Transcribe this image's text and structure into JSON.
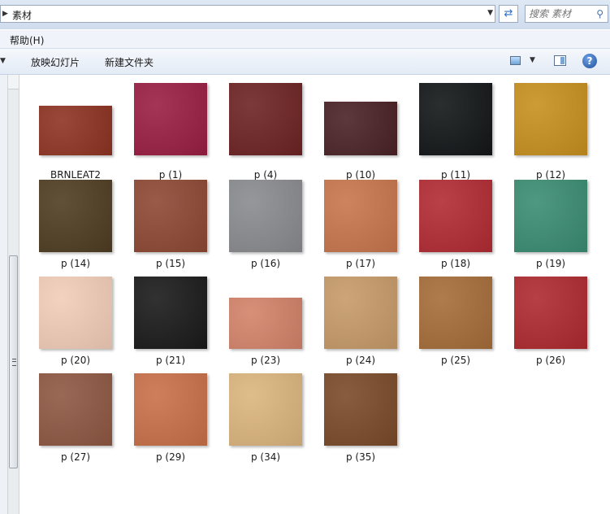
{
  "address": {
    "path": "素材"
  },
  "search": {
    "placeholder": "搜索 素材"
  },
  "menu": {
    "help_label": "帮助(H)"
  },
  "toolbar": {
    "slideshow_label": "放映幻灯片",
    "new_folder_label": "新建文件夹"
  },
  "icons": {
    "back": "triangle-right-icon",
    "dropdown": "chevron-down-icon",
    "refresh": "refresh-icon",
    "search": "search-icon",
    "views": "change-view-icon",
    "preview_pane": "preview-pane-icon",
    "help": "help-icon"
  },
  "files": [
    {
      "name": "BRNLEAT2",
      "color": "#8e3322"
    },
    {
      "name": "p (1)",
      "color": "#9b1e44"
    },
    {
      "name": "p (4)",
      "color": "#6e2324"
    },
    {
      "name": "p (10)",
      "color": "#4a2226"
    },
    {
      "name": "p (11)",
      "color": "#131618"
    },
    {
      "name": "p (12)",
      "color": "#c8901f"
    },
    {
      "name": "p (14)",
      "color": "#4f3d22"
    },
    {
      "name": "p (15)",
      "color": "#8e4934"
    },
    {
      "name": "p (16)",
      "color": "#8a8b8f"
    },
    {
      "name": "p (17)",
      "color": "#c8764c"
    },
    {
      "name": "p (18)",
      "color": "#b22b33"
    },
    {
      "name": "p (19)",
      "color": "#3b8c72"
    },
    {
      "name": "p (20)",
      "color": "#f2cdb8"
    },
    {
      "name": "p (21)",
      "color": "#1b1a1a"
    },
    {
      "name": "p (23)",
      "color": "#d4836a"
    },
    {
      "name": "p (24)",
      "color": "#c69a69"
    },
    {
      "name": "p (25)",
      "color": "#a66d3a"
    },
    {
      "name": "p (26)",
      "color": "#ad2a2f"
    },
    {
      "name": "p (27)",
      "color": "#8e5843"
    },
    {
      "name": "p (29)",
      "color": "#c97049"
    },
    {
      "name": "p (34)",
      "color": "#dcb57e"
    },
    {
      "name": "p (35)",
      "color": "#7a4a2a"
    }
  ]
}
